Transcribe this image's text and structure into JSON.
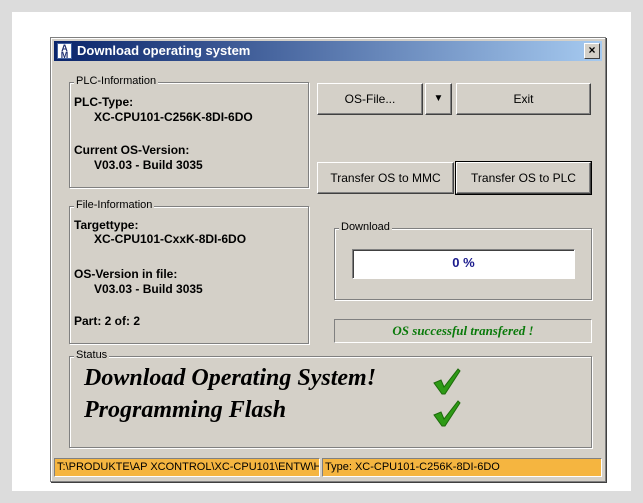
{
  "window": {
    "title": "Download operating system",
    "close_label": "×"
  },
  "plc_info": {
    "group_label": "PLC-Information",
    "type_label": "PLC-Type:",
    "type_value": "XC-CPU101-C256K-8DI-6DO",
    "os_label": "Current OS-Version:",
    "os_value": "V03.03 - Build 3035"
  },
  "file_info": {
    "group_label": "File-Information",
    "target_label": "Targettype:",
    "target_value": "XC-CPU101-CxxK-8DI-6DO",
    "os_label": "OS-Version in file:",
    "os_value": "V03.03 - Build 3035",
    "part_text": "Part: 2 of: 2"
  },
  "buttons": {
    "os_file": "OS-File...",
    "dropdown": "▼",
    "exit": "Exit",
    "transfer_mmc": "Transfer OS to MMC",
    "transfer_plc": "Transfer OS to PLC"
  },
  "download": {
    "group_label": "Download",
    "progress_text": "0 %",
    "progress_fraction": 0,
    "message": "OS successful transfered !"
  },
  "status": {
    "group_label": "Status",
    "line1": "Download Operating System!",
    "line2": "Programming Flash",
    "check_color": "#2e9a16"
  },
  "statusbar": {
    "path": "T:\\PRODUKTE\\AP XCONTROL\\XC-CPU101\\ENTW\\He",
    "type": "Type: XC-CPU101-C256K-8DI-6DO"
  },
  "colors": {
    "statusbar_bg": "#f5b540",
    "title_gradient_start": "#0a246a",
    "progress_text": "#1a1a8c",
    "success_text": "#0a7a0a"
  }
}
